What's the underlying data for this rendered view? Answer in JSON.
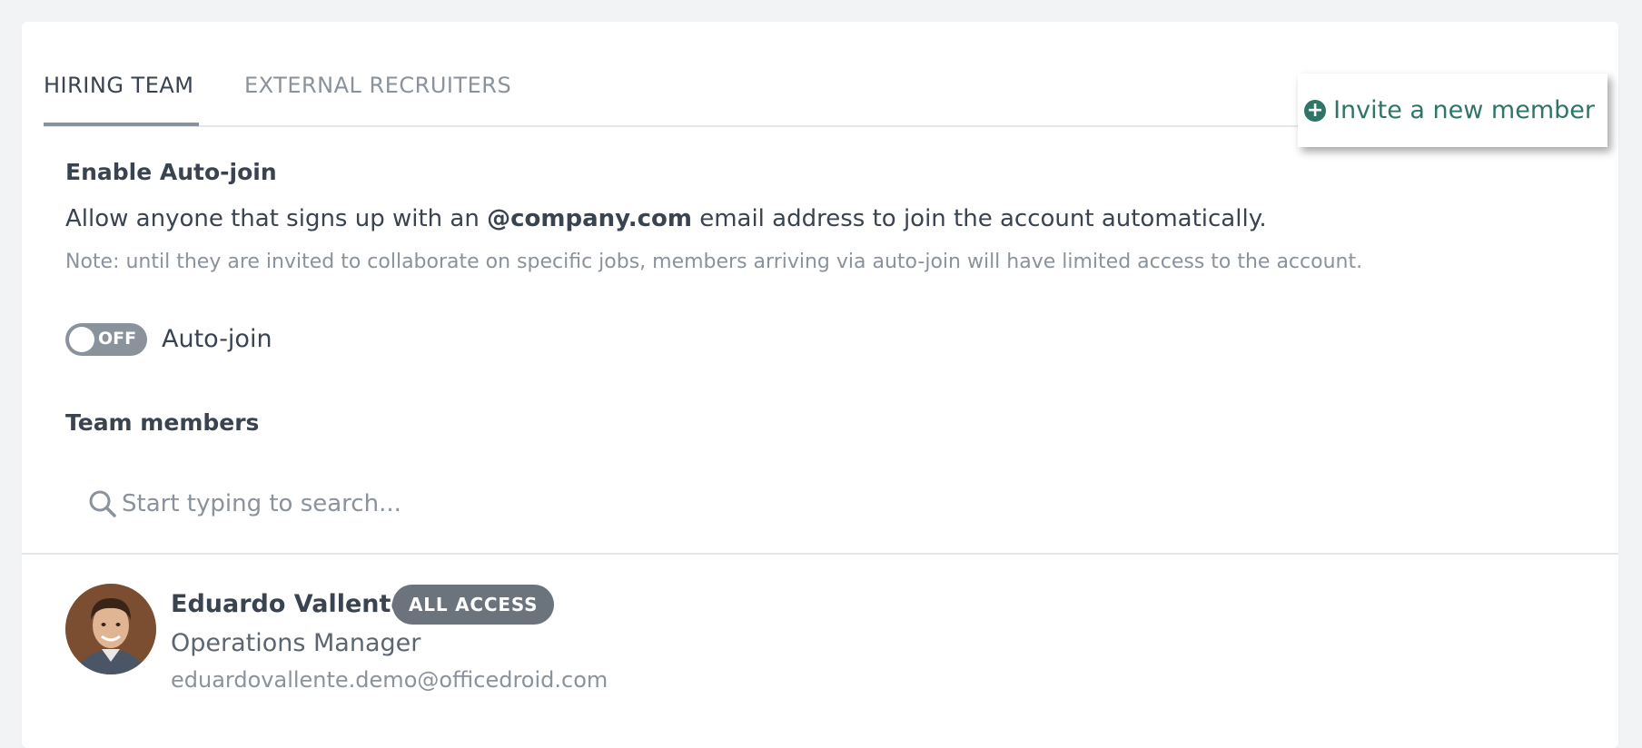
{
  "tabs": [
    {
      "label": "HIRING TEAM",
      "active": true
    },
    {
      "label": "EXTERNAL RECRUITERS",
      "active": false
    }
  ],
  "invite_button": {
    "label": "Invite a new member",
    "icon": "plus-circle-icon"
  },
  "autojoin": {
    "title": "Enable Auto-join",
    "desc_before": "Allow anyone that signs up with an ",
    "domain": "@company.com",
    "desc_after": " email address to join the account automatically.",
    "note": "Note: until they are invited to collaborate on specific jobs, members arriving via auto-join will have limited access to the account.",
    "toggle_state": "OFF",
    "toggle_label": "Auto-join"
  },
  "team": {
    "title": "Team members",
    "search_placeholder": "Start typing to search...",
    "members": [
      {
        "name": "Eduardo Vallente",
        "badge": "ALL ACCESS",
        "role": "Operations Manager",
        "email": "eduardovallente.demo@officedroid.com"
      }
    ]
  },
  "colors": {
    "accent": "#2f7567",
    "text": "#3a4350",
    "muted": "#8a929c",
    "badge_bg": "#6b737d"
  }
}
